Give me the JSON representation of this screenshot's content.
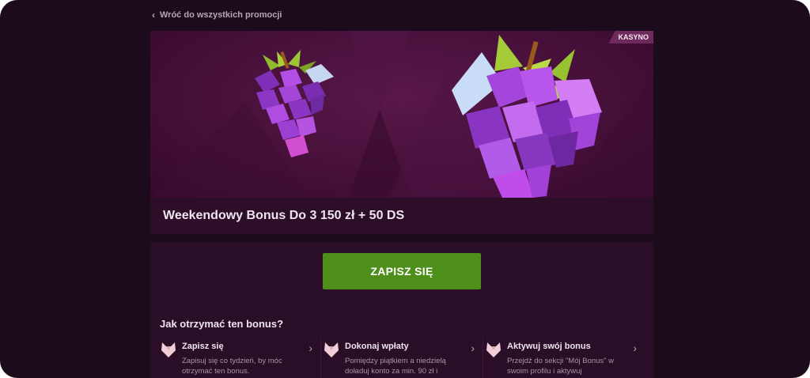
{
  "back_link": {
    "label": "Wróć do wszystkich promocji",
    "icon": "chevron-left-icon"
  },
  "banner": {
    "badge": "KASYNO",
    "artwork": "grapes-illustration"
  },
  "promo": {
    "title": "Weekendowy Bonus Do 3 150 zł + 50 DS"
  },
  "cta": {
    "label": "ZAPISZ SIĘ",
    "color": "#4e8f1c"
  },
  "how_to": {
    "heading": "Jak otrzymać ten bonus?",
    "steps": [
      {
        "title": "Zapisz się",
        "description": "Zapisuj się co tydzień, by móc otrzymać ten bonus.",
        "icon": "wolf-icon"
      },
      {
        "title": "Dokonaj wpłaty",
        "description": "Pomiędzy piątkiem a niedzielą doładuj konto za min. 90 zł i",
        "icon": "wolf-icon"
      },
      {
        "title": "Aktywuj swój bonus",
        "description": "Przejdź do sekcji \"Mój Bonus\" w swoim profilu i aktywuj",
        "icon": "wolf-icon"
      }
    ]
  },
  "colors": {
    "page_bg": "#1c0b1a",
    "card_bg": "#2a0d26",
    "banner_bg": "#46103a",
    "badge_bg": "#6e2a5d"
  }
}
